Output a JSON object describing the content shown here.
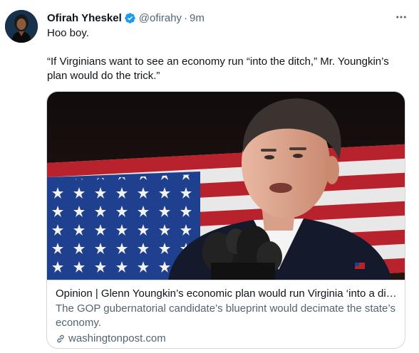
{
  "tweet": {
    "author_name": "Ofirah Yheskel",
    "handle": "@ofirahy",
    "separator": "·",
    "time": "9m",
    "line1": "Hoo boy.",
    "line2": "“If Virginians want to see an economy run “into the ditch,” Mr. Youngkin’s plan would do the trick.”"
  },
  "card": {
    "title": "Opinion | Glenn Youngkin’s economic plan would run Virginia ‘into a ditch’",
    "description": "The GOP gubernatorial candidate’s blueprint would decimate the state’s economy.",
    "domain": "washingtonpost.com"
  },
  "icons": {
    "verified": "verified-badge-icon",
    "more": "more-options-icon",
    "link": "link-icon"
  },
  "colors": {
    "verified_blue": "#1d9bf0",
    "secondary_text": "#536471",
    "primary_text": "#0f1419"
  }
}
